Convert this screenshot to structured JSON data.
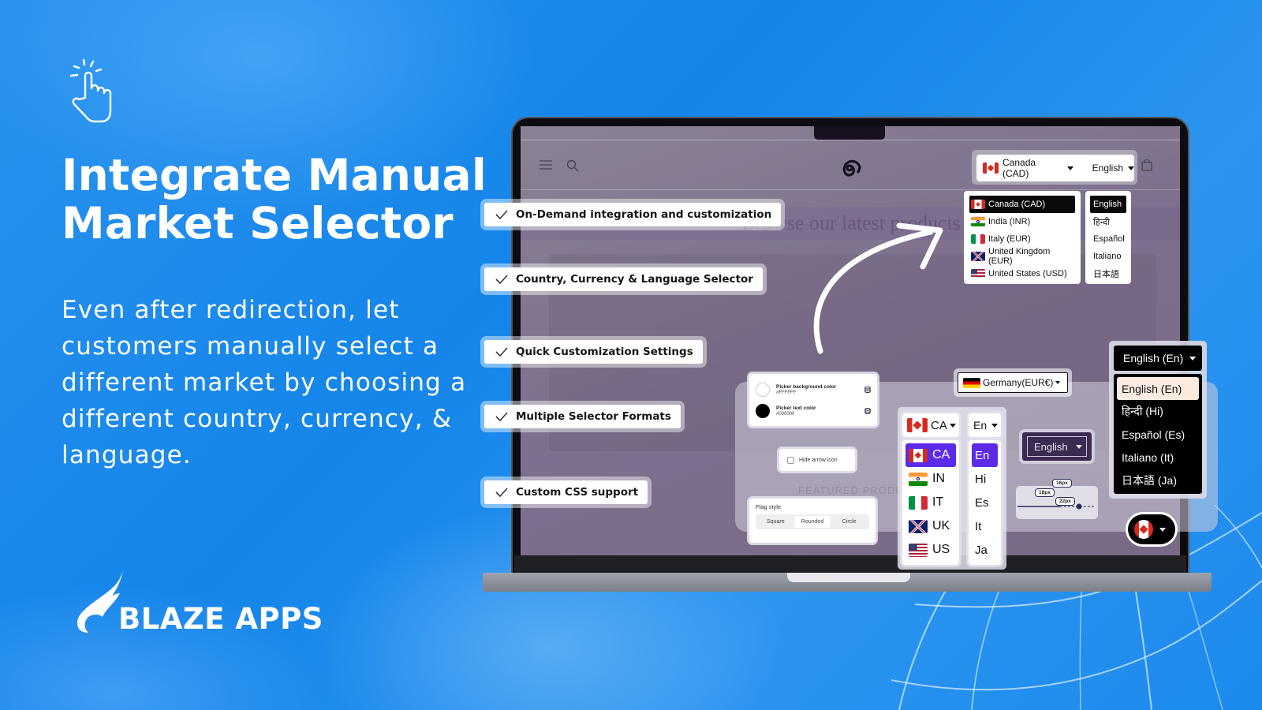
{
  "headline": {
    "title_line1": "Integrate Manual",
    "title_line2": "Market Selector",
    "description": "Even after redirection, let customers manually select a different market by choosing a different country, currency, & language."
  },
  "brand": {
    "name": "BLAZE APPS"
  },
  "features": [
    "On-Demand integration and customization",
    "Country, Currency & Language Selector",
    "Quick Customization Settings",
    "Multiple Selector Formats",
    "Custom CSS support"
  ],
  "store": {
    "hero_text": "Browse our latest products",
    "featured_text": "FEATURED PRODUCTS"
  },
  "top_selector": {
    "country_value": "Canada (CAD)",
    "language_value": "English"
  },
  "country_dropdown": [
    {
      "flag": "ca",
      "label": "Canada (CAD)",
      "selected": true
    },
    {
      "flag": "in",
      "label": "India (INR)"
    },
    {
      "flag": "it",
      "label": "Italy (EUR)"
    },
    {
      "flag": "gb",
      "label": "United Kingdom (EUR)"
    },
    {
      "flag": "us",
      "label": "United States (USD)"
    }
  ],
  "language_dropdown": [
    {
      "label": "English",
      "selected": true
    },
    {
      "label": "हिन्दी"
    },
    {
      "label": "Español"
    },
    {
      "label": "Italiano"
    },
    {
      "label": "日本語"
    }
  ],
  "settings": {
    "picker_bg_label": "Picker background color",
    "picker_bg_value": "#FFFFFF",
    "picker_text_label": "Picker text color",
    "picker_text_value": "#000000",
    "hide_arrow_label": "Hide arrow icon",
    "hide_arrow_checked": false,
    "flag_style_label": "Flag style",
    "flag_style_options": [
      "Square",
      "Rounded",
      "Circle"
    ],
    "flag_style_selected": "Rounded"
  },
  "germany_selector": {
    "value": "Germany(EUR€)"
  },
  "short_selector": {
    "country_value": "CA",
    "language_value": "En",
    "countries": [
      {
        "flag": "ca",
        "code": "CA",
        "selected": true
      },
      {
        "flag": "in",
        "code": "IN"
      },
      {
        "flag": "it",
        "code": "IT"
      },
      {
        "flag": "gb",
        "code": "UK"
      },
      {
        "flag": "us",
        "code": "US"
      }
    ],
    "languages": [
      {
        "code": "En",
        "selected": true
      },
      {
        "code": "Hi"
      },
      {
        "code": "Es"
      },
      {
        "code": "It"
      },
      {
        "code": "Ja"
      }
    ],
    "accent": "#5b2be8"
  },
  "dark_english_selector": {
    "value": "English"
  },
  "size_slider": {
    "labels": [
      "16px",
      "18px",
      "22px"
    ]
  },
  "dark_dropdown": {
    "value": "English (En)",
    "options": [
      {
        "label": "English (En)",
        "selected": true
      },
      {
        "label": "हिन्दी (Hi)"
      },
      {
        "label": "Español (Es)"
      },
      {
        "label": "Italiano (It)"
      },
      {
        "label": "日本語 (Ja)"
      }
    ]
  },
  "round_flag_selector": {
    "flag": "ca"
  },
  "colors": {
    "background": "#1a8bee",
    "dark_selector_bg": "#000000",
    "dark_selector_highlight": "#fbeae0"
  }
}
